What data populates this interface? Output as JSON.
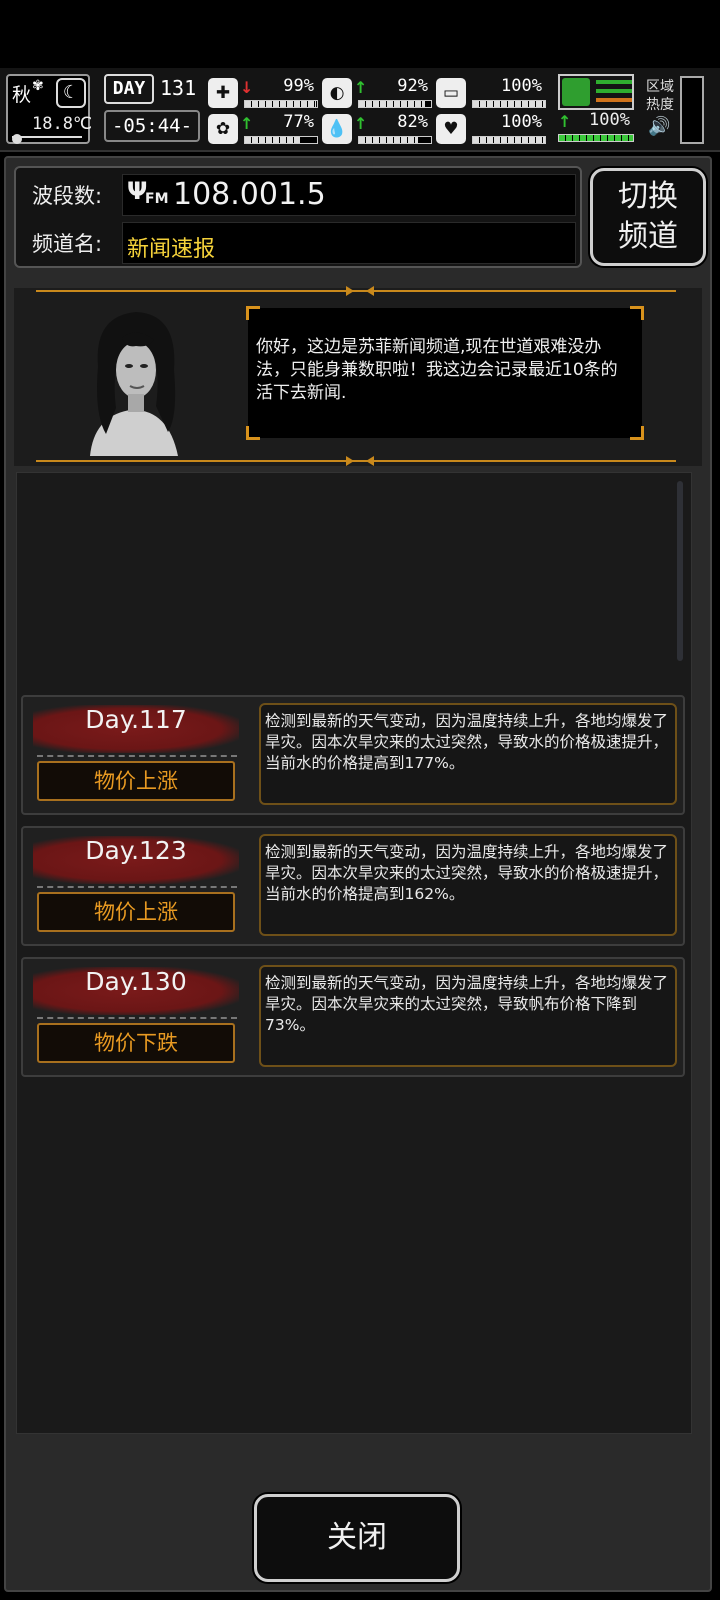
{
  "hud": {
    "season": "秋",
    "temperature": "18.8℃",
    "day_tag": "DAY",
    "day_number": "131",
    "clock": "-05:44-",
    "stats": [
      {
        "icon": "medkit-icon",
        "glyph": "✚",
        "arrow": "↓",
        "arrow_color": "#e03030",
        "value": "99%",
        "level": 0.99
      },
      {
        "icon": "stomach-icon",
        "glyph": "◐",
        "arrow": "↑",
        "arrow_color": "#30c030",
        "value": "92%",
        "level": 0.92
      },
      {
        "icon": "bladder-icon",
        "glyph": "▭",
        "arrow": "",
        "arrow_color": "#30c030",
        "value": "100%",
        "level": 1.0
      },
      {
        "icon": "brain-icon",
        "glyph": "✿",
        "arrow": "↑",
        "arrow_color": "#30c030",
        "value": "77%",
        "level": 0.77
      },
      {
        "icon": "water-drop-icon",
        "glyph": "💧",
        "arrow": "↑",
        "arrow_color": "#30c030",
        "value": "82%",
        "level": 0.82
      },
      {
        "icon": "heart-icon",
        "glyph": "♥",
        "arrow": "",
        "arrow_color": "#30c030",
        "value": "100%",
        "level": 1.0
      }
    ],
    "stamina_value": "100%",
    "stamina_level": 1.0,
    "region_label": "区域热度"
  },
  "radio": {
    "band_label": "波段数:",
    "fm_label": "FM",
    "frequency": "108.001.5",
    "channel_label": "频道名:",
    "channel_name": "新闻速报",
    "switch_label_1": "切换",
    "switch_label_2": "频道"
  },
  "host": {
    "message": "你好，这边是苏菲新闻频道,现在世道艰难没办法，只能身兼数职啦！我这边会记录最近10条的活下去新闻."
  },
  "news": [
    {
      "day": "Day.117",
      "tag": "物价上涨",
      "text": "检测到最新的天气变动，因为温度持续上升，各地均爆发了旱灾。因本次旱灾来的太过突然，导致水的价格极速提升，当前水的价格提高到177%。"
    },
    {
      "day": "Day.123",
      "tag": "物价上涨",
      "text": "检测到最新的天气变动，因为温度持续上升，各地均爆发了旱灾。因本次旱灾来的太过突然，导致水的价格极速提升，当前水的价格提高到162%。"
    },
    {
      "day": "Day.130",
      "tag": "物价下跌",
      "text": "检测到最新的天气变动，因为温度持续上升，各地均爆发了旱灾。因本次旱灾来的太过突然，导致帆布价格下降到73%。"
    }
  ],
  "close_label": "关闭",
  "colors": {
    "accent_orange": "#d8921c",
    "channel_yellow": "#f5d23a",
    "splash_red": "#7a1a1a"
  }
}
